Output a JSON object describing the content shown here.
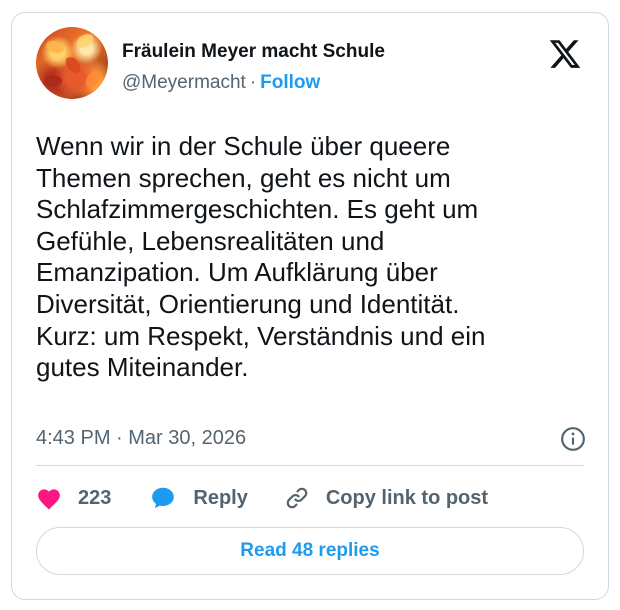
{
  "author": {
    "name": "Fräulein Meyer macht Schule",
    "handle": "@Meyermacht",
    "separator": "·",
    "follow_label": "Follow"
  },
  "tweet": {
    "text": "Wenn wir in der Schule über queere\nThemen sprechen, geht es nicht um\nSchlafzimmergeschichten. Es geht um\nGefühle, Lebensrealitäten und\nEmanzipation. Um Aufklärung über\nDiversität, Orientierung und Identität.\nKurz: um Respekt, Verständnis und ein\ngutes Miteinander.",
    "timestamp": "4:43 PM · Mar 30, 2026"
  },
  "actions": {
    "like_count": "223",
    "reply_label": "Reply",
    "copy_label": "Copy link to post"
  },
  "footer": {
    "read_replies_label": "Read 48 replies"
  },
  "icons": {
    "brand": "x-logo-icon",
    "info": "info-icon",
    "like": "heart-icon",
    "reply": "reply-bubble-icon",
    "copy": "link-icon"
  },
  "colors": {
    "accent": "#1d9bf0",
    "like": "#f91880",
    "text": "#0f1419",
    "secondary": "#536471",
    "border": "#cfd9de"
  }
}
